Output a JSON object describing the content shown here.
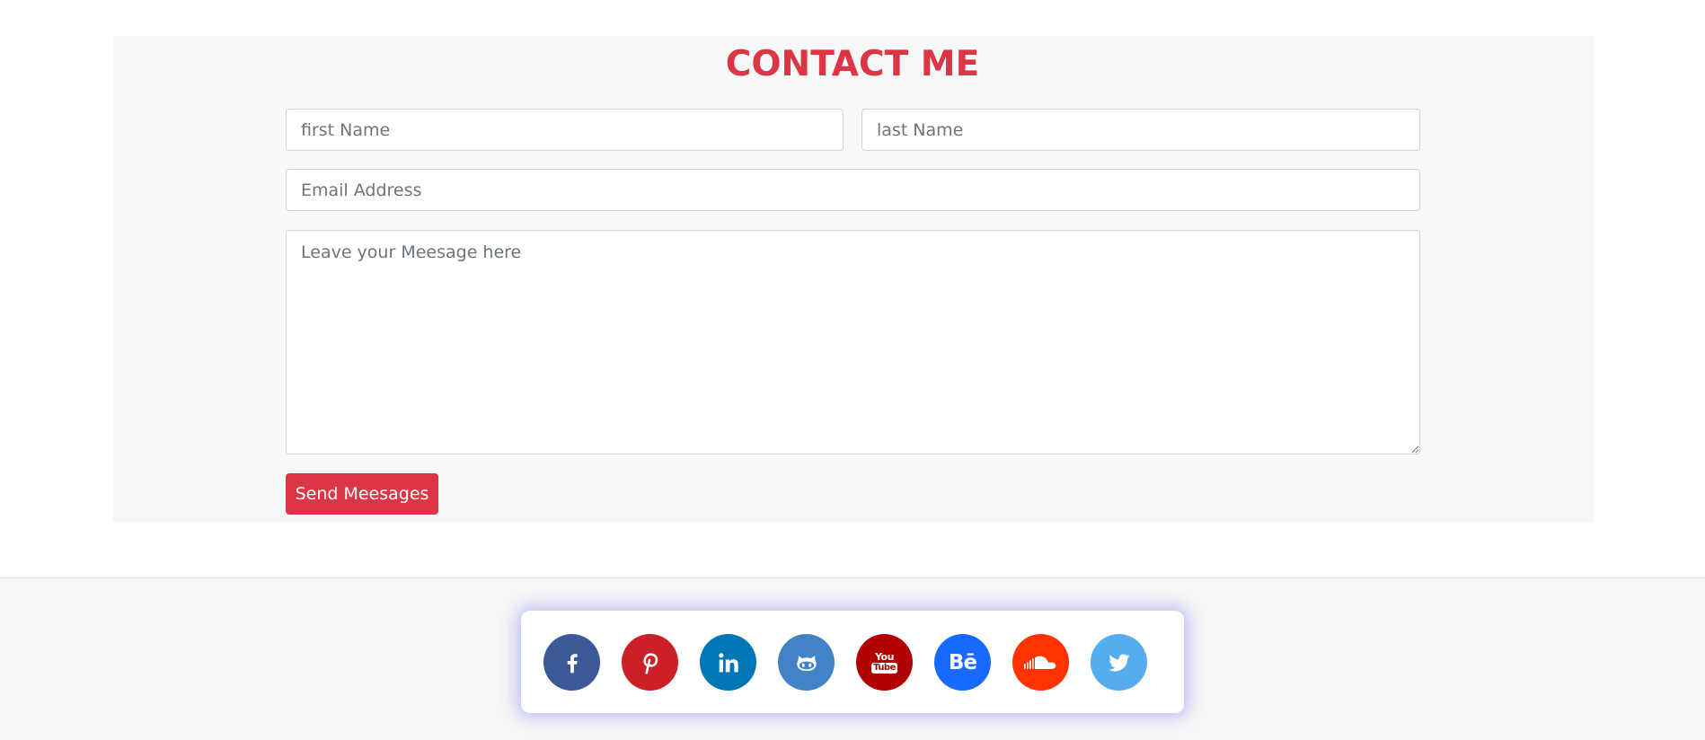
{
  "contact": {
    "title": "CONTACT ME",
    "first_name_placeholder": "first Name",
    "last_name_placeholder": "last Name",
    "email_placeholder": "Email Address",
    "message_placeholder": "Leave your Meesage here",
    "send_label": "Send Meesages",
    "accent_color": "#dc3545"
  },
  "social": [
    {
      "name": "facebook",
      "icon": "facebook-icon",
      "color": "#3b5998"
    },
    {
      "name": "pinterest",
      "icon": "pinterest-icon",
      "color": "#cb2027"
    },
    {
      "name": "linkedin",
      "icon": "linkedin-icon",
      "color": "#0077b5"
    },
    {
      "name": "github",
      "icon": "github-icon",
      "color": "#4183c4"
    },
    {
      "name": "youtube",
      "icon": "youtube-icon",
      "color": "#b00000",
      "text_top": "You",
      "text_bottom": "Tube"
    },
    {
      "name": "behance",
      "icon": "behance-icon",
      "color": "#1769ff",
      "text": "Bē"
    },
    {
      "name": "soundcloud",
      "icon": "soundcloud-icon",
      "color": "#ff3300"
    },
    {
      "name": "twitter",
      "icon": "twitter-icon",
      "color": "#55acee"
    }
  ]
}
